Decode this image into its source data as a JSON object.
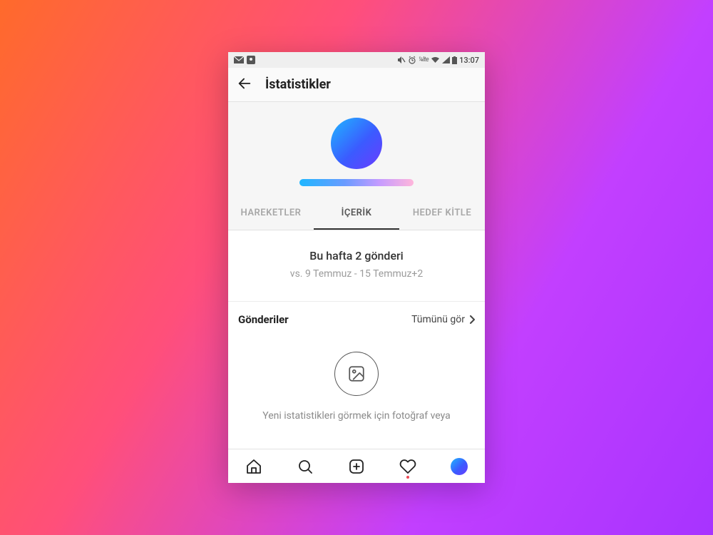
{
  "status": {
    "time": "13:07",
    "network": "lte"
  },
  "header": {
    "title": "İstatistikler"
  },
  "tabs": {
    "items": [
      {
        "label": "HAREKETLER"
      },
      {
        "label": "İÇERİK"
      },
      {
        "label": "HEDEF KİTLE"
      }
    ],
    "active_index": 1
  },
  "summary": {
    "headline": "Bu hafta 2 gönderi",
    "subline": "vs. 9 Temmuz - 15 Temmuz+2"
  },
  "posts_section": {
    "title": "Gönderiler",
    "see_all": "Tümünü gör",
    "empty_hint": "Yeni istatistikleri görmek için fotoğraf veya"
  }
}
